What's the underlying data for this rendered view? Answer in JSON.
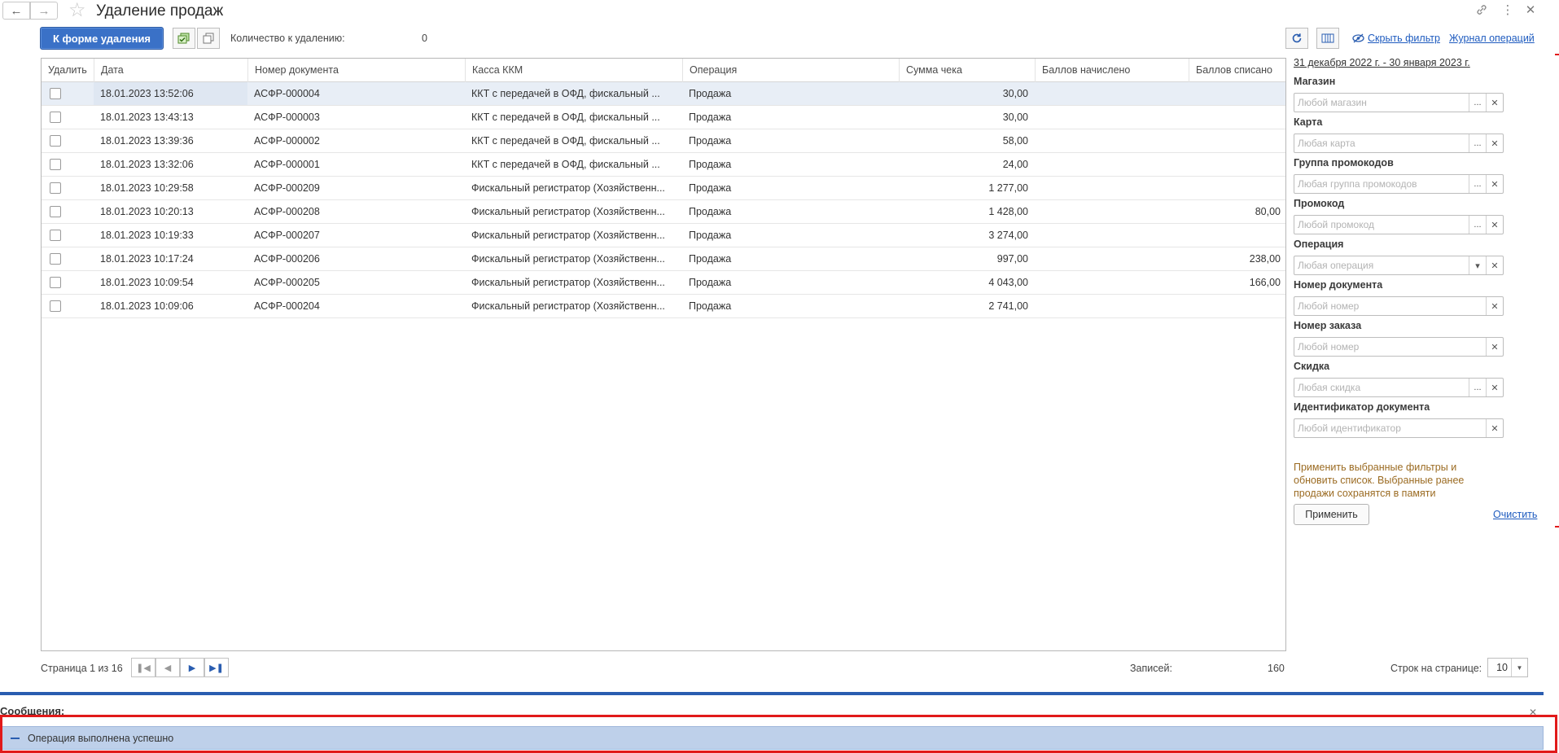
{
  "window": {
    "title": "Удаление продаж",
    "back_icon": "arrow-left-icon",
    "forward_icon": "arrow-right-icon"
  },
  "toolbar": {
    "to_delete_form_label": "К форме удаления",
    "count_label": "Количество к удалению:",
    "count_value": "0",
    "hide_filter_label": "Скрыть фильтр",
    "operations_log_label": "Журнал операций"
  },
  "table": {
    "columns": [
      "Удалить",
      "Дата",
      "Номер документа",
      "Касса ККМ",
      "Операция",
      "Сумма чека",
      "Баллов начислено",
      "Баллов списано"
    ],
    "rows": [
      {
        "date": "18.01.2023 13:52:06",
        "doc": "АСФР-000004",
        "kkm": "ККТ с передачей в ОФД, фискальный ...",
        "op": "Продажа",
        "sum": "30,00",
        "accrued": "",
        "written": ""
      },
      {
        "date": "18.01.2023 13:43:13",
        "doc": "АСФР-000003",
        "kkm": "ККТ с передачей в ОФД, фискальный ...",
        "op": "Продажа",
        "sum": "30,00",
        "accrued": "",
        "written": ""
      },
      {
        "date": "18.01.2023 13:39:36",
        "doc": "АСФР-000002",
        "kkm": "ККТ с передачей в ОФД, фискальный ...",
        "op": "Продажа",
        "sum": "58,00",
        "accrued": "",
        "written": ""
      },
      {
        "date": "18.01.2023 13:32:06",
        "doc": "АСФР-000001",
        "kkm": "ККТ с передачей в ОФД, фискальный ...",
        "op": "Продажа",
        "sum": "24,00",
        "accrued": "",
        "written": ""
      },
      {
        "date": "18.01.2023 10:29:58",
        "doc": "АСФР-000209",
        "kkm": "Фискальный регистратор (Хозяйственн...",
        "op": "Продажа",
        "sum": "1 277,00",
        "accrued": "",
        "written": ""
      },
      {
        "date": "18.01.2023 10:20:13",
        "doc": "АСФР-000208",
        "kkm": "Фискальный регистратор (Хозяйственн...",
        "op": "Продажа",
        "sum": "1 428,00",
        "accrued": "",
        "written": "80,00"
      },
      {
        "date": "18.01.2023 10:19:33",
        "doc": "АСФР-000207",
        "kkm": "Фискальный регистратор (Хозяйственн...",
        "op": "Продажа",
        "sum": "3 274,00",
        "accrued": "",
        "written": ""
      },
      {
        "date": "18.01.2023 10:17:24",
        "doc": "АСФР-000206",
        "kkm": "Фискальный регистратор (Хозяйственн...",
        "op": "Продажа",
        "sum": "997,00",
        "accrued": "",
        "written": "238,00"
      },
      {
        "date": "18.01.2023 10:09:54",
        "doc": "АСФР-000205",
        "kkm": "Фискальный регистратор (Хозяйственн...",
        "op": "Продажа",
        "sum": "4 043,00",
        "accrued": "",
        "written": "166,00"
      },
      {
        "date": "18.01.2023 10:09:06",
        "doc": "АСФР-000204",
        "kkm": "Фискальный регистратор (Хозяйственн...",
        "op": "Продажа",
        "sum": "2 741,00",
        "accrued": "",
        "written": ""
      }
    ]
  },
  "pager": {
    "page_text": "Страница 1 из 16",
    "records_label": "Записей:",
    "records_value": "160",
    "rows_per_page_label": "Строк на странице:",
    "rows_per_page_value": "10"
  },
  "filters": {
    "period": "31 декабря 2022 г. - 30 января 2023 г.",
    "fields": [
      {
        "label": "Магазин",
        "placeholder": "Любой магазин",
        "choose": true,
        "dropdown": false
      },
      {
        "label": "Карта",
        "placeholder": "Любая карта",
        "choose": true,
        "dropdown": false
      },
      {
        "label": "Группа промокодов",
        "placeholder": "Любая группа промокодов",
        "choose": true,
        "dropdown": false
      },
      {
        "label": "Промокод",
        "placeholder": "Любой промокод",
        "choose": true,
        "dropdown": false
      },
      {
        "label": "Операция",
        "placeholder": "Любая операция",
        "choose": false,
        "dropdown": true
      },
      {
        "label": "Номер документа",
        "placeholder": "Любой номер",
        "choose": false,
        "dropdown": false
      },
      {
        "label": "Номер заказа",
        "placeholder": "Любой номер",
        "choose": false,
        "dropdown": false
      },
      {
        "label": "Скидка",
        "placeholder": "Любая скидка",
        "choose": true,
        "dropdown": false
      },
      {
        "label": "Идентификатор документа",
        "placeholder": "Любой идентификатор",
        "choose": false,
        "dropdown": false
      }
    ],
    "hint": "Применить выбранные фильтры и обновить список. Выбранные ранее продажи сохранятся в памяти",
    "apply_label": "Применить",
    "clear_label": "Очистить"
  },
  "messages": {
    "title": "Сообщения:",
    "items": [
      "Операция выполнена успешно"
    ]
  },
  "colors": {
    "primary_button": "#3a71c7",
    "link": "#1e5bbf",
    "hint_text": "#9b6b22",
    "message_bar": "#bed0ea",
    "highlight_box": "#e11a1a",
    "divider": "#2a5db0"
  }
}
